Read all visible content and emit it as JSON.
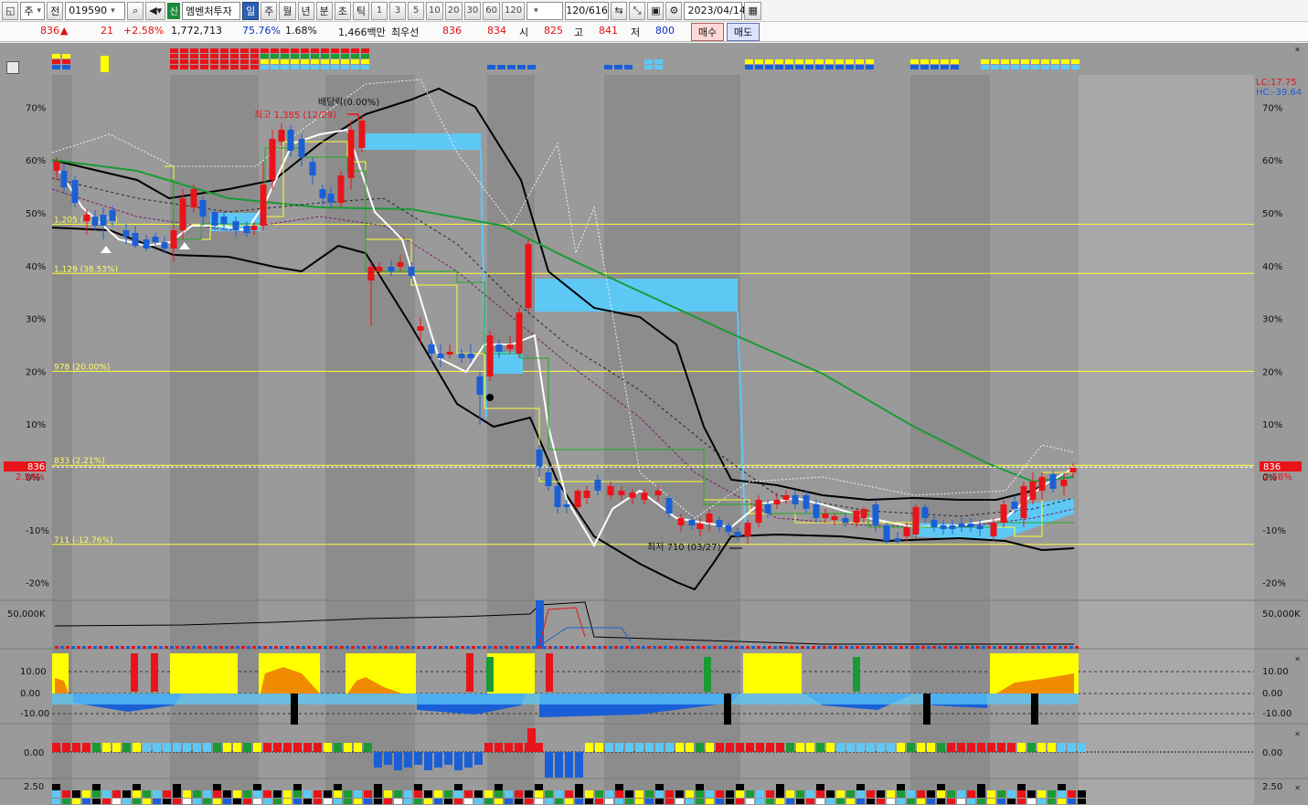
{
  "toolbar": {
    "market": "주",
    "prev_label": "전",
    "code": "019590",
    "name_badge": "신",
    "stock_name": "엠벤처투자",
    "periods": [
      "일",
      "주",
      "월",
      "년",
      "분",
      "초",
      "틱"
    ],
    "intervals": [
      "1",
      "3",
      "5",
      "10",
      "20",
      "30",
      "60",
      "120"
    ],
    "count": "120/616",
    "date": "2023/04/14"
  },
  "quote": {
    "price": "836",
    "arrow": "▲",
    "change": "21",
    "change_pct": "+2.58%",
    "volume": "1,772,713",
    "vol_ratio": "75.76%",
    "turnover": "1.68%",
    "amount": "1,466백만",
    "best_label": "최우선",
    "ask": "836",
    "bid": "834",
    "open_label": "시",
    "open": "825",
    "high_label": "고",
    "high": "841",
    "low_label": "저",
    "low": "800",
    "buy_label": "매수",
    "sell_label": "매도"
  },
  "price_panel": {
    "pct_ticks": [
      "70%",
      "60%",
      "50%",
      "40%",
      "30%",
      "20%",
      "10%",
      "0%",
      "-10%",
      "-20%"
    ],
    "fib_levels": [
      {
        "label": "1,205 (47.85%)",
        "pct": 47.85
      },
      {
        "label": "1,129 (38.53%)",
        "pct": 38.53
      },
      {
        "label": "978 (20.00%)",
        "pct": 20.0
      },
      {
        "label": "833 (2.21%)",
        "pct": 2.21
      },
      {
        "label": "711 (-12.76%)",
        "pct": -12.76
      }
    ],
    "current_price_tag": "836",
    "current_pct_tag": "2.58%",
    "lc_label": "LC:17.75",
    "hc_label": "HC:-39.64",
    "high_annotation": "최고 1,385 (12/29)",
    "low_annotation": "최저 710 (03/27)",
    "dividend_annotation": "배당락(0.00%)"
  },
  "volume_panel": {
    "tick": "50,000K"
  },
  "osc_panel": {
    "ticks": [
      "10.00",
      "0.00",
      "-10.00"
    ]
  },
  "osc2_panel": {
    "ticks": [
      "0.00"
    ]
  },
  "osc3_panel": {
    "ticks": [
      "2.50"
    ]
  },
  "colors": {
    "up": "#e8141a",
    "down": "#1b5fd6",
    "ma_green": "#1a9a35",
    "band": "#000000",
    "fill_cyan": "#5ec8f5",
    "fib": "#ffff33",
    "bg_dark": "#8e8e8e",
    "bg_light": "#a4a4a4"
  }
}
